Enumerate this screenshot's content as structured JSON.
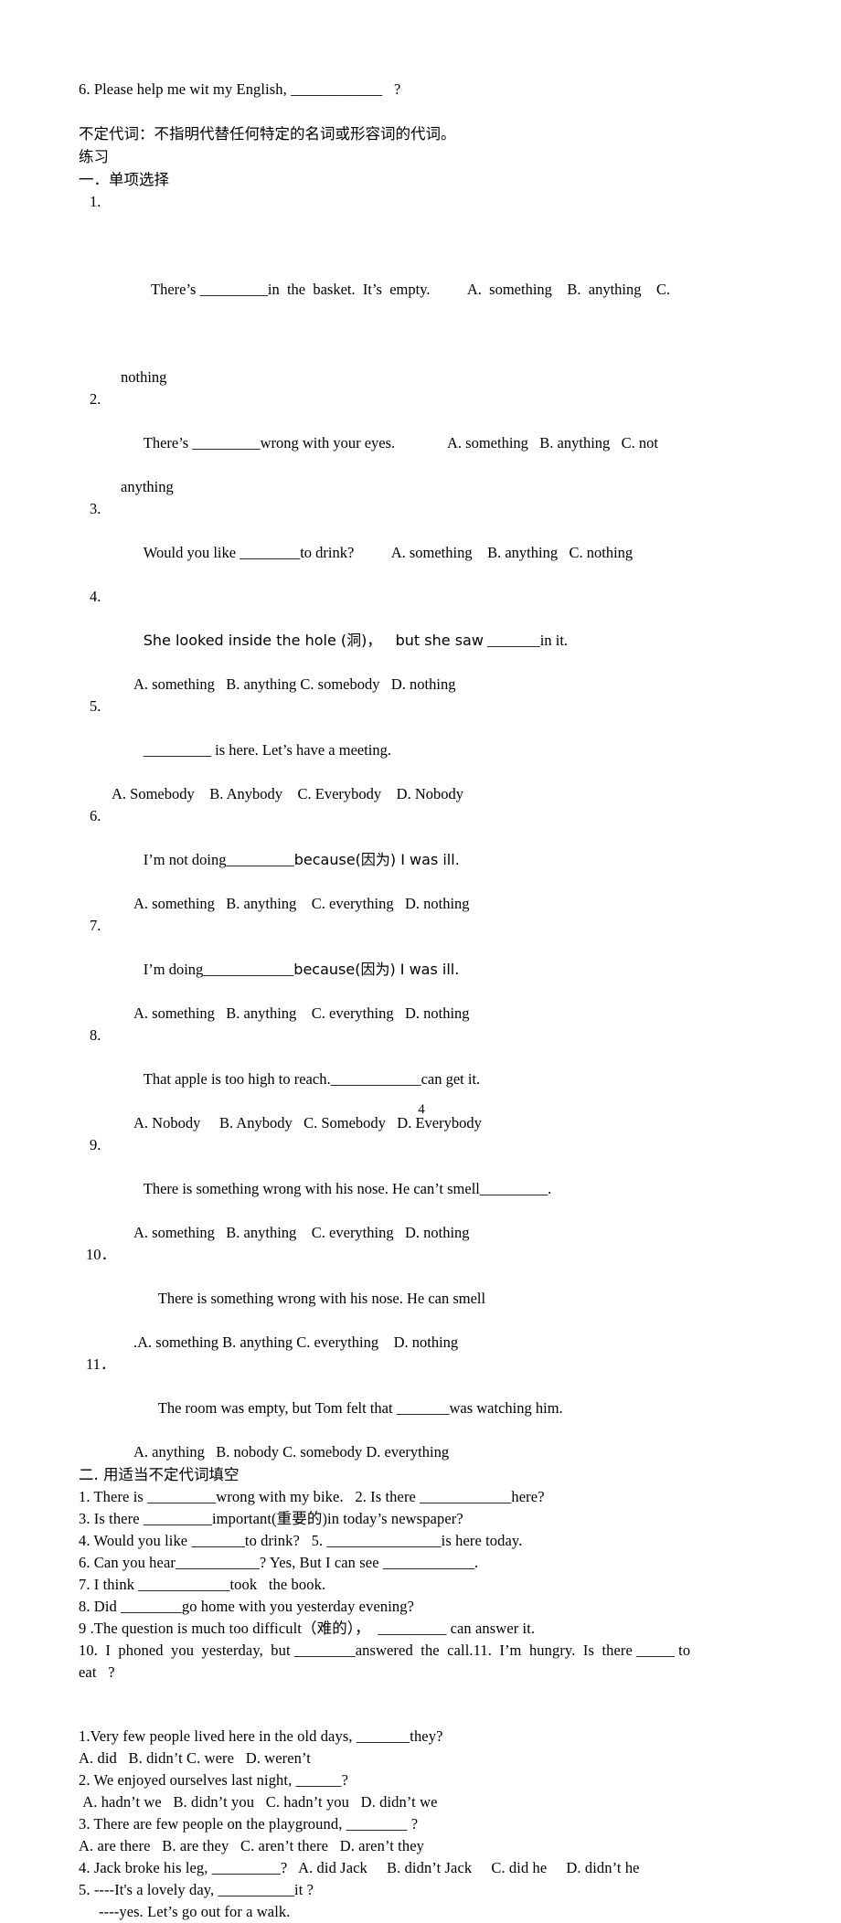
{
  "document": {
    "page_number": "4",
    "top_question": {
      "number": "6.",
      "text_before": "Please help me wit my English,",
      "blank": "____________",
      "text_after": "?"
    },
    "definition_line": "不定代词：不指明代替任何特定的名词或形容词的代词。",
    "exercises_label": "练习",
    "section_one": {
      "heading": "一．单项选择",
      "questions": [
        {
          "num": "1.",
          "stem_a": "There’s",
          "blank": "_________",
          "stem_b": "in  the  basket.  It’s  empty.",
          "options_inline": "A.  something    B.  anything    C.",
          "options_wrap": "nothing"
        },
        {
          "num": "2.",
          "stem_a": "There’s",
          "blank": "_________",
          "stem_b": "wrong with your eyes.",
          "options_inline": "A. something   B. anything   C. not",
          "options_wrap": "anything"
        },
        {
          "num": "3.",
          "stem_a": "Would you like",
          "blank": "________",
          "stem_b": "to drink?",
          "options_inline": "A. something    B. anything   C. nothing"
        },
        {
          "num": "4.",
          "stem_a": "She looked inside the hole (洞)，   but she saw",
          "blank": "_______",
          "stem_b": "in it.",
          "options": "A. something   B. anything C. somebody   D. nothing"
        },
        {
          "num": "5.",
          "stem_a": "",
          "blank": "_________",
          "stem_b": "is here. Let’s have a meeting.",
          "options": "A. Somebody    B. Anybody    C. Everybody    D. Nobody"
        },
        {
          "num": "6.",
          "stem_a": "I’m not doing",
          "blank": "_________",
          "stem_b": "because(因为) I was ill.",
          "options": "A. something   B. anything    C. everything   D. nothing"
        },
        {
          "num": "7.",
          "stem_a": "I’m doing",
          "blank": "____________",
          "stem_b": "because(因为) I was ill.",
          "options": "A. something   B. anything    C. everything   D. nothing"
        },
        {
          "num": "8.",
          "stem_a": "That apple is too high to reach.",
          "blank": "____________",
          "stem_b": "can get it.",
          "options": "A. Nobody     B. Anybody   C. Somebody   D. Everybody"
        },
        {
          "num": "9.",
          "stem_a": "There is something wrong with his nose. He can’t smell",
          "blank": "_________",
          "stem_b": ".",
          "options": "A. something   B. anything    C. everything   D. nothing"
        },
        {
          "num": "10．",
          "stem_a": "There is something wrong with his nose. He can smell",
          "blank": "",
          "stem_b": "",
          "options": ".A. something B. anything C. everything    D. nothing"
        },
        {
          "num": "11．",
          "stem_a": "The room was empty, but Tom felt that",
          "blank": "_______",
          "stem_b": "was watching him.",
          "options": "A. anything   B. nobody C. somebody D. everything"
        }
      ]
    },
    "section_two": {
      "heading": "二. 用适当不定代词填空",
      "lines": [
        {
          "id": "fill-1-2",
          "parts": [
            {
              "t": "1. There is "
            },
            {
              "b": "_________"
            },
            {
              "t": "wrong with my bike.   2. Is there "
            },
            {
              "b": "____________"
            },
            {
              "t": "here?"
            }
          ]
        },
        {
          "id": "fill-3",
          "parts": [
            {
              "t": "3. Is there "
            },
            {
              "b": "_________"
            },
            {
              "t": "important(重要的)in today’s newspaper?"
            }
          ]
        },
        {
          "id": "fill-4-5",
          "parts": [
            {
              "t": "4. Would you like "
            },
            {
              "b": "_______"
            },
            {
              "t": "to drink?   5. "
            },
            {
              "b": "_______________"
            },
            {
              "t": "is here today."
            }
          ]
        },
        {
          "id": "fill-6",
          "parts": [
            {
              "t": "6. Can you hear"
            },
            {
              "b": "___________"
            },
            {
              "t": "? Yes, But I can see "
            },
            {
              "b": "____________"
            },
            {
              "t": "."
            }
          ]
        },
        {
          "id": "fill-7",
          "parts": [
            {
              "t": "7. I think "
            },
            {
              "b": "____________"
            },
            {
              "t": "took   the book."
            }
          ]
        },
        {
          "id": "fill-8",
          "parts": [
            {
              "t": "8. Did "
            },
            {
              "b": "________"
            },
            {
              "t": "go home with you yesterday evening?"
            }
          ]
        },
        {
          "id": "fill-9",
          "parts": [
            {
              "t": "9 .The question is much too difficult（难的），  "
            },
            {
              "b": "_________"
            },
            {
              "t": " can answer it."
            }
          ]
        }
      ],
      "line_10_left": "10.  I  phoned  you  yesterday,  but",
      "line_10_blank": "________",
      "line_10_mid": "answered  the  call.11.  I’m  hungry.  Is  there",
      "line_10_blank2": "_____",
      "line_10_right": "to",
      "line_10_wrap": "eat   ?"
    },
    "section_three": {
      "questions": [
        {
          "num": "1.",
          "stem_a": "Very few people lived here in the old days,",
          "blank": "_______",
          "stem_b": "they?",
          "options": "A. did   B. didn’t C. were   D. weren’t"
        },
        {
          "num": "2.",
          "stem_a": "We enjoyed ourselves last night,",
          "blank": "______",
          "stem_b": "?",
          "options": " A. hadn’t we   B. didn’t you   C. hadn’t you   D. didn’t we"
        },
        {
          "num": "3.",
          "stem_a": "There are few people on the playground,",
          "blank": "________",
          "stem_b": "?",
          "options": "A. are there   B. are they   C. aren’t there   D. aren’t they"
        },
        {
          "num": "4.",
          "stem_a": "Jack broke his leg,",
          "blank": "_________",
          "stem_b": "?   A. did Jack     B. didn’t Jack     C. did he     D. didn’t he",
          "options": ""
        },
        {
          "num": "5.",
          "stem_a": "----It's a lovely day,",
          "blank": "__________",
          "stem_b": "it ?",
          "options": "----yes. Let’s go out for a walk."
        }
      ]
    }
  }
}
